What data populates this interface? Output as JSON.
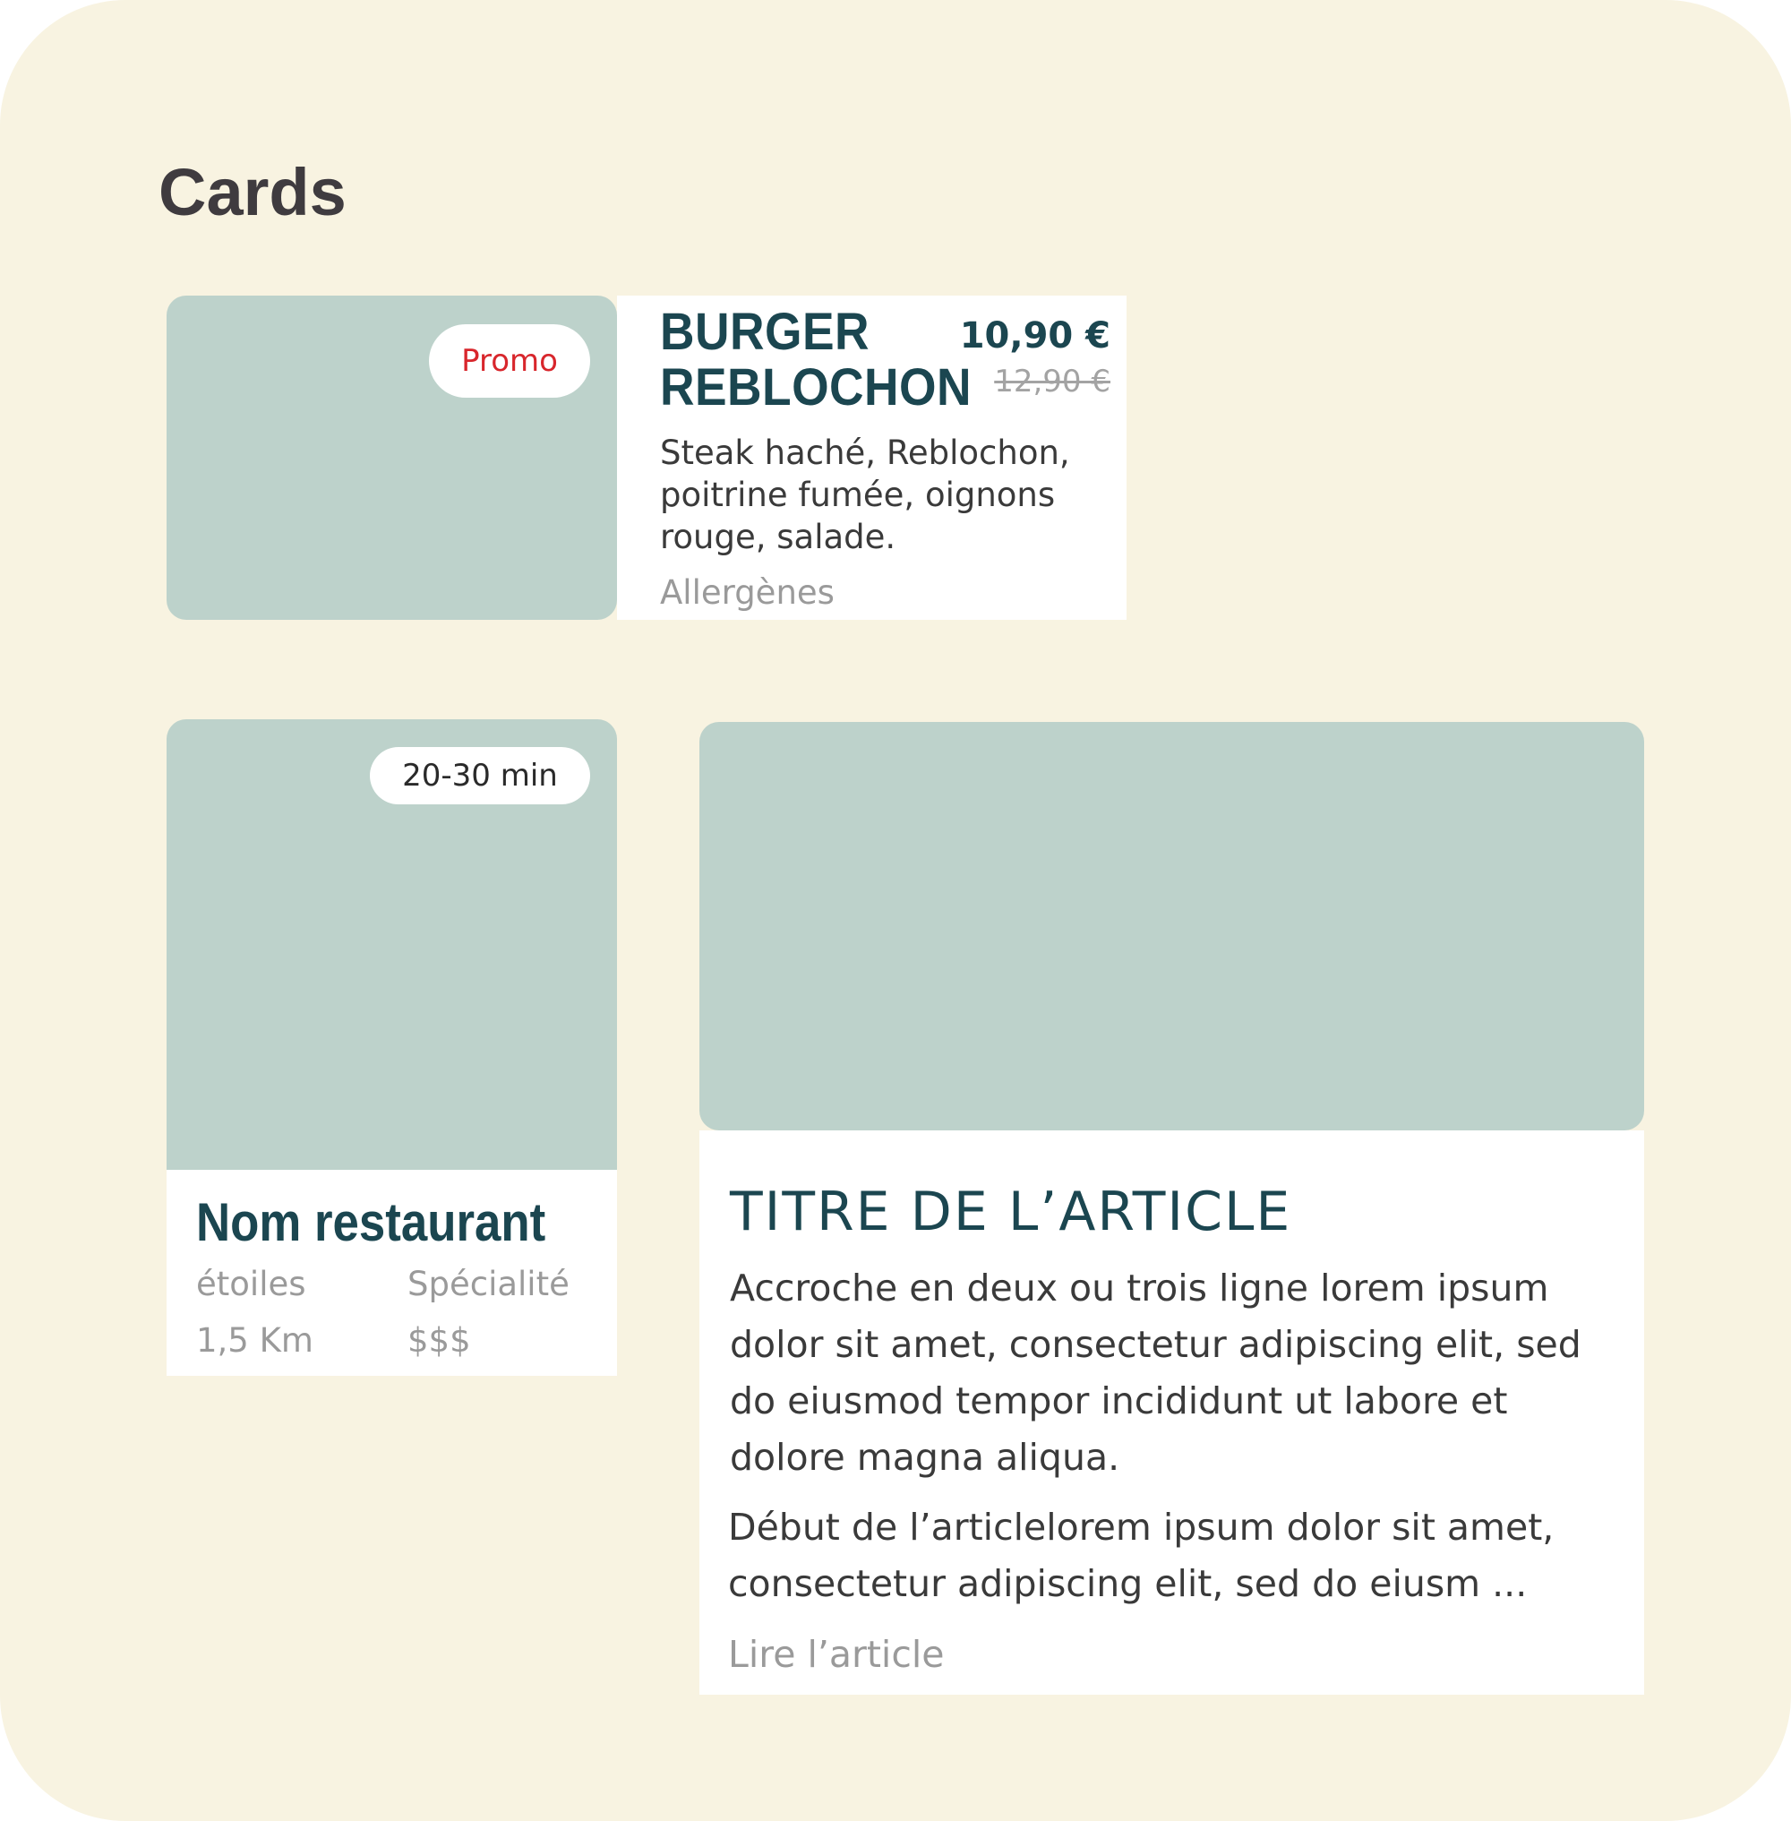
{
  "section": {
    "title": "Cards"
  },
  "colors": {
    "page_background": "#f8f3e1",
    "image_placeholder": "#bdd2cb",
    "heading": "#1b4650",
    "promo": "#d8262c",
    "muted": "#9a9a9a"
  },
  "product_card": {
    "badge": "Promo",
    "name": "BURGER REBLOCHON",
    "price_current": "10,90 €",
    "price_old": "12,90 €",
    "description": "Steak haché, Reblochon, poitrine fumée, oignons rouge, salade.",
    "link": "Allergènes"
  },
  "restaurant_card": {
    "badge": "20-30 min",
    "name": "Nom restaurant",
    "rating": "étoiles",
    "specialty": "Spécialité",
    "distance": "1,5 Km",
    "price_level": "$$$"
  },
  "article_card": {
    "title": "TITRE DE L’ARTICLE",
    "hook": "Accroche en deux ou trois ligne lorem ipsum dolor sit amet, consectetur adipiscing elit, sed do eiusmod tempor incididunt ut labore et dolore magna aliqua.",
    "excerpt": "Début de l’articlelorem ipsum dolor sit amet, consectetur adipiscing elit, sed do eiusm ...",
    "link": "Lire l’article"
  }
}
